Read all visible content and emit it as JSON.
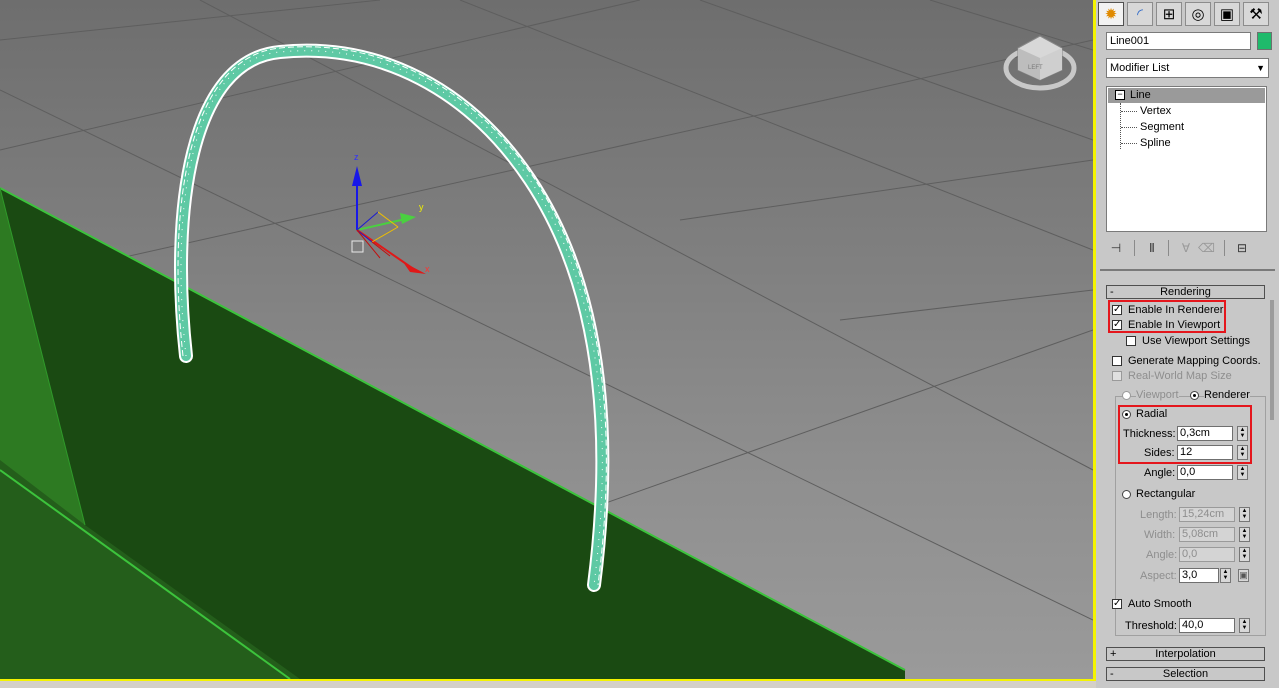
{
  "viewport": {
    "axis_labels": {
      "z": "z",
      "y": "y",
      "x": "x"
    },
    "viewcube_label": "LEFT",
    "colors": {
      "grid": "#5a5a5a",
      "plane": "#1a4d14",
      "plane_edge": "#3cc33c",
      "arc": "#5ec9a4",
      "active_border": "#f4f400"
    }
  },
  "panel": {
    "tabs": [
      {
        "icon": "create-icon",
        "glyph": "✹",
        "active": true
      },
      {
        "icon": "modify-icon",
        "glyph": "◜",
        "active": false
      },
      {
        "icon": "hierarchy-icon",
        "glyph": "⊞",
        "active": false
      },
      {
        "icon": "motion-icon",
        "glyph": "◎",
        "active": false
      },
      {
        "icon": "display-icon",
        "glyph": "▣",
        "active": false
      },
      {
        "icon": "utilities-icon",
        "glyph": "⚒",
        "active": false
      }
    ],
    "object_name": "Line001",
    "object_color": "#1fba6b",
    "modifier_list": "Modifier List",
    "stack": {
      "base": "Line",
      "subobjects": [
        "Vertex",
        "Segment",
        "Spline"
      ]
    },
    "stack_tools": [
      "pin-stack-icon",
      "show-end-result-icon",
      "make-unique-icon",
      "remove-modifier-icon",
      "configure-sets-icon"
    ],
    "rendering": {
      "title": "Rendering",
      "enable_in_renderer": "Enable In Renderer",
      "enable_in_viewport": "Enable In Viewport",
      "use_viewport_settings": "Use Viewport Settings",
      "generate_mapping": "Generate Mapping Coords.",
      "real_world_map": "Real-World Map Size",
      "viewport_radio": "Viewport",
      "renderer_radio": "Renderer",
      "radial": "Radial",
      "thickness_label": "Thickness:",
      "thickness": "0,3cm",
      "sides_label": "Sides:",
      "sides": "12",
      "angle_label": "Angle:",
      "angle": "0,0",
      "rectangular": "Rectangular",
      "length_label": "Length:",
      "length": "15,24cm",
      "width_label": "Width:",
      "width": "5,08cm",
      "rect_angle_label": "Angle:",
      "rect_angle": "0,0",
      "aspect_label": "Aspect:",
      "aspect": "3,0",
      "auto_smooth": "Auto Smooth",
      "threshold_label": "Threshold:",
      "threshold": "40,0"
    },
    "interpolation": "Interpolation",
    "selection": "Selection"
  }
}
